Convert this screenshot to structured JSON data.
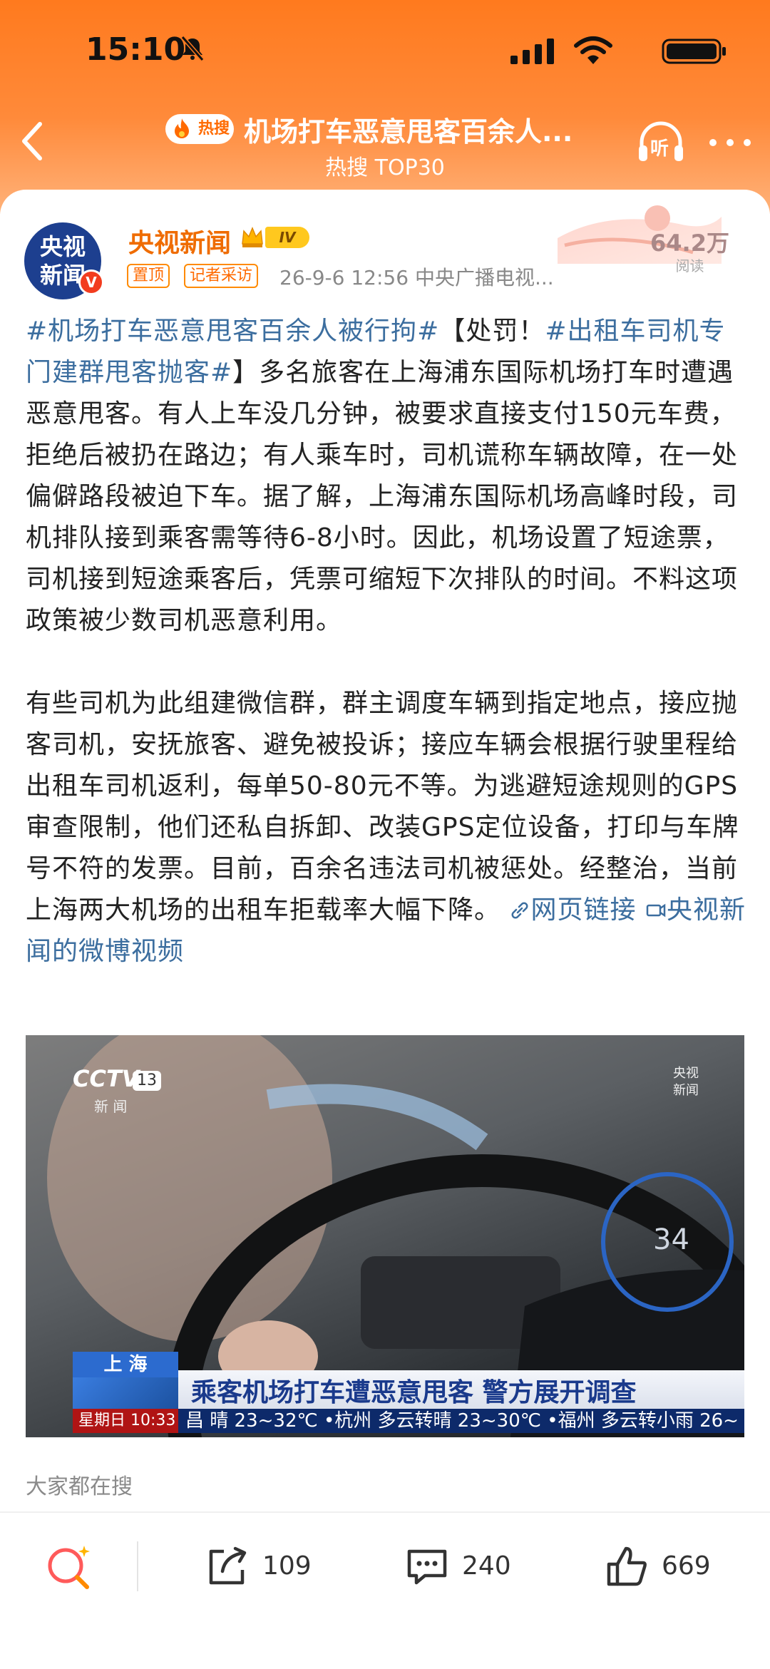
{
  "status_bar": {
    "time": "15:10"
  },
  "header": {
    "hot_badge": "热搜",
    "title": "机场打车恶意甩客百余人...",
    "subtitle": "热搜 TOP30",
    "listen_label": "听"
  },
  "post": {
    "avatar_line1": "央视",
    "avatar_line2": "新闻",
    "verified_badge": "V",
    "author": "央视新闻",
    "level": "IV",
    "tags": [
      "置顶",
      "记者采访"
    ],
    "meta": "26-9-6 12:56  中央广播电视...",
    "views": "64.2万",
    "views_label": "阅读",
    "para1": {
      "hashtag1": "#机场打车恶意甩客百余人被行拘#",
      "bracket_open": "【处罚！",
      "hashtag2": "#出租车司机专门建群甩客抛客#",
      "rest": "】多名旅客在上海浦东国际机场打车时遭遇恶意甩客。有人上车没几分钟，被要求直接支付150元车费，拒绝后被扔在路边；有人乘车时，司机谎称车辆故障，在一处偏僻路段被迫下车。据了解，上海浦东国际机场高峰时段，司机排队接到乘客需等待6-8小时。因此，机场设置了短途票，司机接到短途乘客后，凭票可缩短下次排队的时间。不料这项政策被少数司机恶意利用。"
    },
    "para2": "有些司机为此组建微信群，群主调度车辆到指定地点，接应抛客司机，安抚旅客、避免被投诉；接应车辆会根据行驶里程给出租车司机返利，每单50-80元不等。为逃避短途规则的GPS审查限制，他们还私自拆卸、改装GPS定位设备，打印与车牌号不符的发票。目前，百余名违法司机被惩处。经整治，当前上海两大机场的出租车拒载率大幅下降。",
    "link_web": "网页链接",
    "link_video": "央视新闻的微博视频"
  },
  "video": {
    "channel": "CCTV",
    "channel_num": "13",
    "channel_sub": "新 闻",
    "watermark_line1": "央视",
    "watermark_line2": "新闻",
    "speedo": "34",
    "caption_city": "上 海",
    "caption_headline": "乘客机场打车遭恶意甩客 警方展开调查",
    "caption_day": "星期日  10:33",
    "caption_ticker": "昌 晴 23~32℃  •杭州 多云转晴 23~30℃  •福州 多云转小雨 26~"
  },
  "section_label": "大家都在搜",
  "toolbar": {
    "share_count": "109",
    "comment_count": "240",
    "like_count": "669"
  }
}
